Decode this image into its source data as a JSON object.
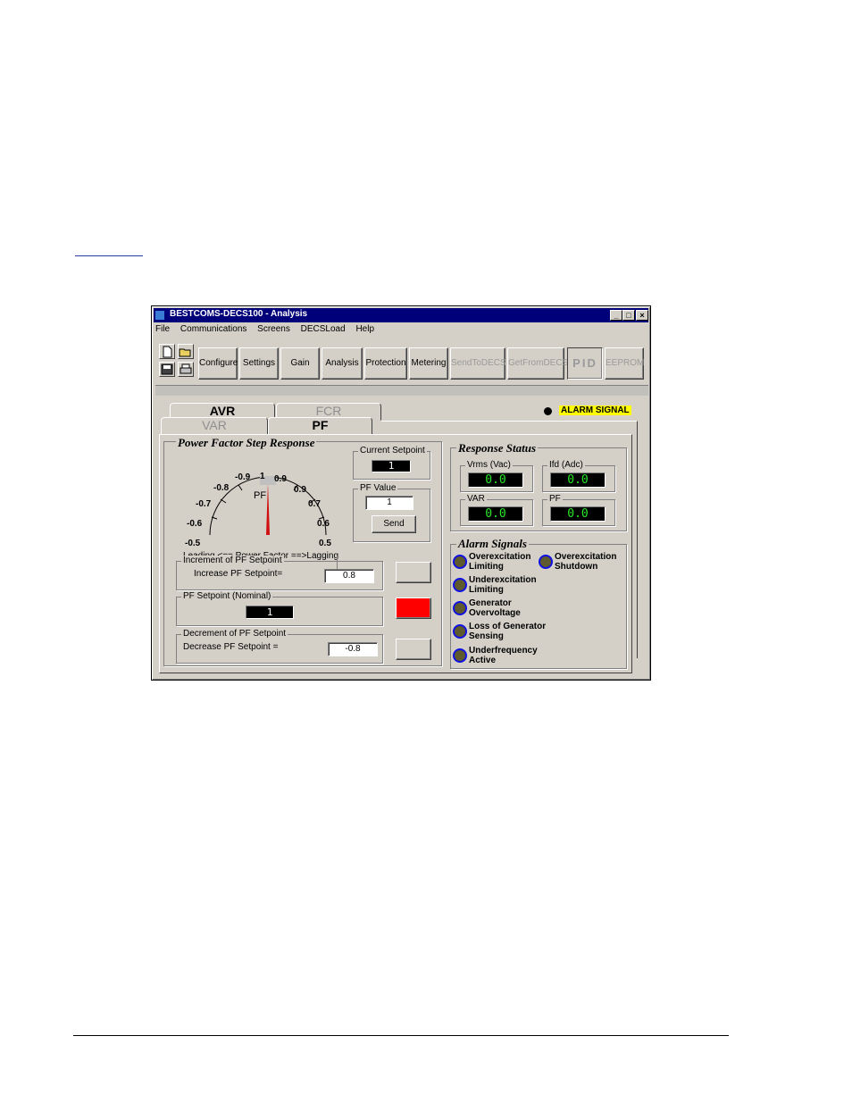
{
  "window": {
    "title": "BESTCOMS-DECS100 - Analysis",
    "controls": [
      "_",
      "□",
      "×"
    ]
  },
  "menu": [
    "File",
    "Communications",
    "Screens",
    "DECSLoad",
    "Help"
  ],
  "toolbar": {
    "buttons": [
      "Configure",
      "Settings",
      "Gain",
      "Analysis",
      "Protection",
      "Metering",
      "SendToDECS",
      "GetFromDECS",
      "PID",
      "EEPROM"
    ]
  },
  "tabs": {
    "top": [
      "AVR",
      "FCR"
    ],
    "bottom": [
      "VAR",
      "PF"
    ]
  },
  "alarm_signal": {
    "label": "ALARM SIGNAL",
    "color": "#ffff00"
  },
  "pf_step": {
    "title": "Power Factor Step Response",
    "gauge": {
      "center_label": "PF",
      "top_label": "1",
      "left_labels": [
        "-0.9",
        "-0.8",
        "-0.7",
        "-0.6",
        "-0.5"
      ],
      "right_labels": [
        "0.9",
        "0.9",
        "0.7",
        "0.6",
        "0.5"
      ],
      "scale_caption": "Leading <== Power Factor ==>Lagging",
      "needle_color": "#d01010"
    },
    "current_setpoint": {
      "label": "Current Setpoint",
      "value": "1"
    },
    "pf_value": {
      "label": "PF Value",
      "value": "1",
      "send_label": "Send"
    },
    "increment": {
      "group": "Increment of PF Setpoint",
      "label": "Increase PF Setpoint=",
      "value": "0.8"
    },
    "nominal": {
      "group": "PF Setpoint (Nominal)",
      "value": "1"
    },
    "decrement": {
      "group": "Decrement of PF Setpoint",
      "label": "Decrease  PF Setpoint =",
      "value": "-0.8"
    },
    "step_active_color": "#ff0000"
  },
  "response_status": {
    "title": "Response Status",
    "meters": [
      {
        "label": "Vrms (Vac)",
        "value": "0.0"
      },
      {
        "label": "Ifd (Adc)",
        "value": "0.0"
      },
      {
        "label": "VAR",
        "value": "0.0"
      },
      {
        "label": "PF",
        "value": "0.0"
      }
    ]
  },
  "alarm_signals": {
    "title": "Alarm Signals",
    "items": [
      {
        "line1": "Overexcitation",
        "line2": "Limiting"
      },
      {
        "line1": "Overexcitation",
        "line2": "Shutdown"
      },
      {
        "line1": "Underexcitation",
        "line2": "Limiting"
      },
      {
        "line1": "Generator",
        "line2": "Overvoltage"
      },
      {
        "line1": "Loss of Generator",
        "line2": "Sensing"
      },
      {
        "line1": "Underfrequency",
        "line2": "Active"
      }
    ]
  }
}
